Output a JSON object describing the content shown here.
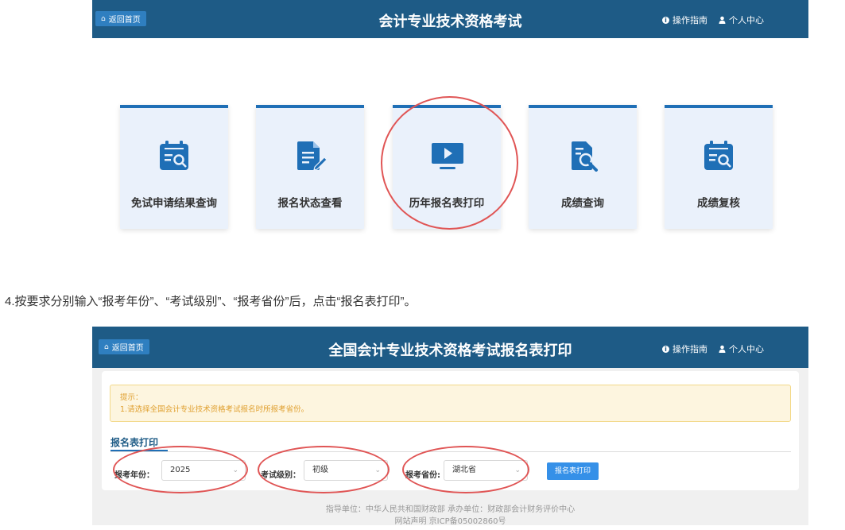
{
  "top_screen": {
    "back_label": "返回首页",
    "title": "会计专业技术资格考试",
    "guide_label": "操作指南",
    "user_label": "个人中心",
    "cards": [
      {
        "label": "免试申请结果查询",
        "icon": "calendar-search-icon"
      },
      {
        "label": "报名状态查看",
        "icon": "document-edit-icon"
      },
      {
        "label": "历年报名表打印",
        "icon": "monitor-play-icon"
      },
      {
        "label": "成绩查询",
        "icon": "document-search-icon"
      },
      {
        "label": "成绩复核",
        "icon": "calendar-search-icon"
      }
    ]
  },
  "instruction": "4.按要求分别输入“报考年份”、“考试级别”、“报考省份”后，点击“报名表打印”。",
  "form_screen": {
    "back_label": "返回首页",
    "title": "全国会计专业技术资格考试报名表打印",
    "guide_label": "操作指南",
    "user_label": "个人中心",
    "tip_title": "提示：",
    "tip_text": "1.请选择全国会计专业技术资格考试报名时所报考省份。",
    "tab_label": "报名表打印",
    "year_label": "报考年份：",
    "year_value": "2025",
    "level_label": "考试级别：",
    "level_value": "初级",
    "province_label": "报考省份:",
    "province_value": "湖北省",
    "print_button": "报名表打印",
    "footer_line1": "指导单位：中华人民共和国财政部     承办单位：财政部会计财务评价中心",
    "footer_line2": "网站声明     京ICP备05002860号"
  },
  "colors": {
    "header_bg": "#1e5b86",
    "accent": "#1f6fb6",
    "highlight_circle": "#e05555"
  }
}
